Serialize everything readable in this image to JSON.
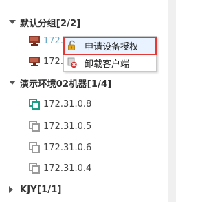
{
  "groups": [
    {
      "label": "默认分组[2/2]",
      "expanded": true,
      "nodes": [
        {
          "label": "172.",
          "icon": "monitor-icon",
          "status": "online"
        },
        {
          "label": "172.3",
          "icon": "monitor-icon",
          "status": "online"
        }
      ]
    },
    {
      "label": "演示环境02机器[1/4]",
      "expanded": true,
      "nodes": [
        {
          "label": "172.31.0.8",
          "icon": "network-node-icon",
          "status": "online"
        },
        {
          "label": "172.31.0.5",
          "icon": "network-node-icon",
          "status": "offline"
        },
        {
          "label": "172.31.0.6",
          "icon": "network-node-icon",
          "status": "offline"
        },
        {
          "label": "172.31.0.4",
          "icon": "network-node-icon",
          "status": "offline"
        }
      ]
    },
    {
      "label": "KJY[1/1]",
      "expanded": false,
      "nodes": []
    }
  ],
  "context_menu": {
    "items": [
      {
        "label": "申请设备授权",
        "icon": "unlock-icon",
        "highlighted": true
      },
      {
        "label": "卸载客户端",
        "icon": "uninstall-icon",
        "highlighted": false
      }
    ]
  },
  "colors": {
    "online": "#1e9e84",
    "offline": "#9a9a9a",
    "monitor": "#8b3a2a",
    "highlight_border": "#e53935"
  }
}
